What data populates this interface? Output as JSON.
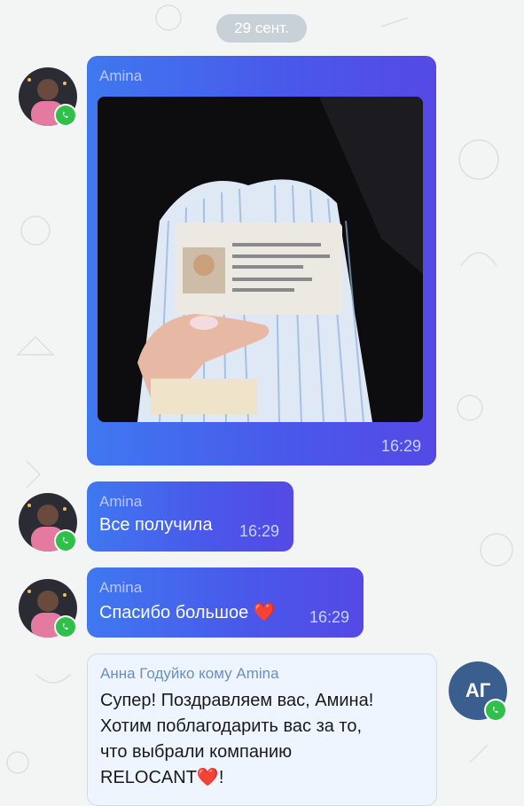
{
  "date_separator": "29 сент.",
  "messages": [
    {
      "sender": "Amina",
      "type": "photo",
      "time": "16:29"
    },
    {
      "sender": "Amina",
      "text": "Все получила",
      "time": "16:29"
    },
    {
      "sender": "Amina",
      "text": "Спасибо большое",
      "emoji": "❤️",
      "time": "16:29"
    }
  ],
  "reply": {
    "sender_line": "Анна Годуйко  кому Amina",
    "text": "Супер! Поздравляем вас, Амина!\nХотим поблагодарить вас за то,\nчто выбрали компанию\nRELOCANT",
    "emoji": "❤️",
    "tail": "!",
    "avatar_initials": "АГ"
  },
  "colors": {
    "bubble_gradient_start": "#3f78f0",
    "bubble_gradient_end": "#5549e6",
    "whatsapp_green": "#2fbf4b",
    "reply_bg": "#eef5ff"
  }
}
